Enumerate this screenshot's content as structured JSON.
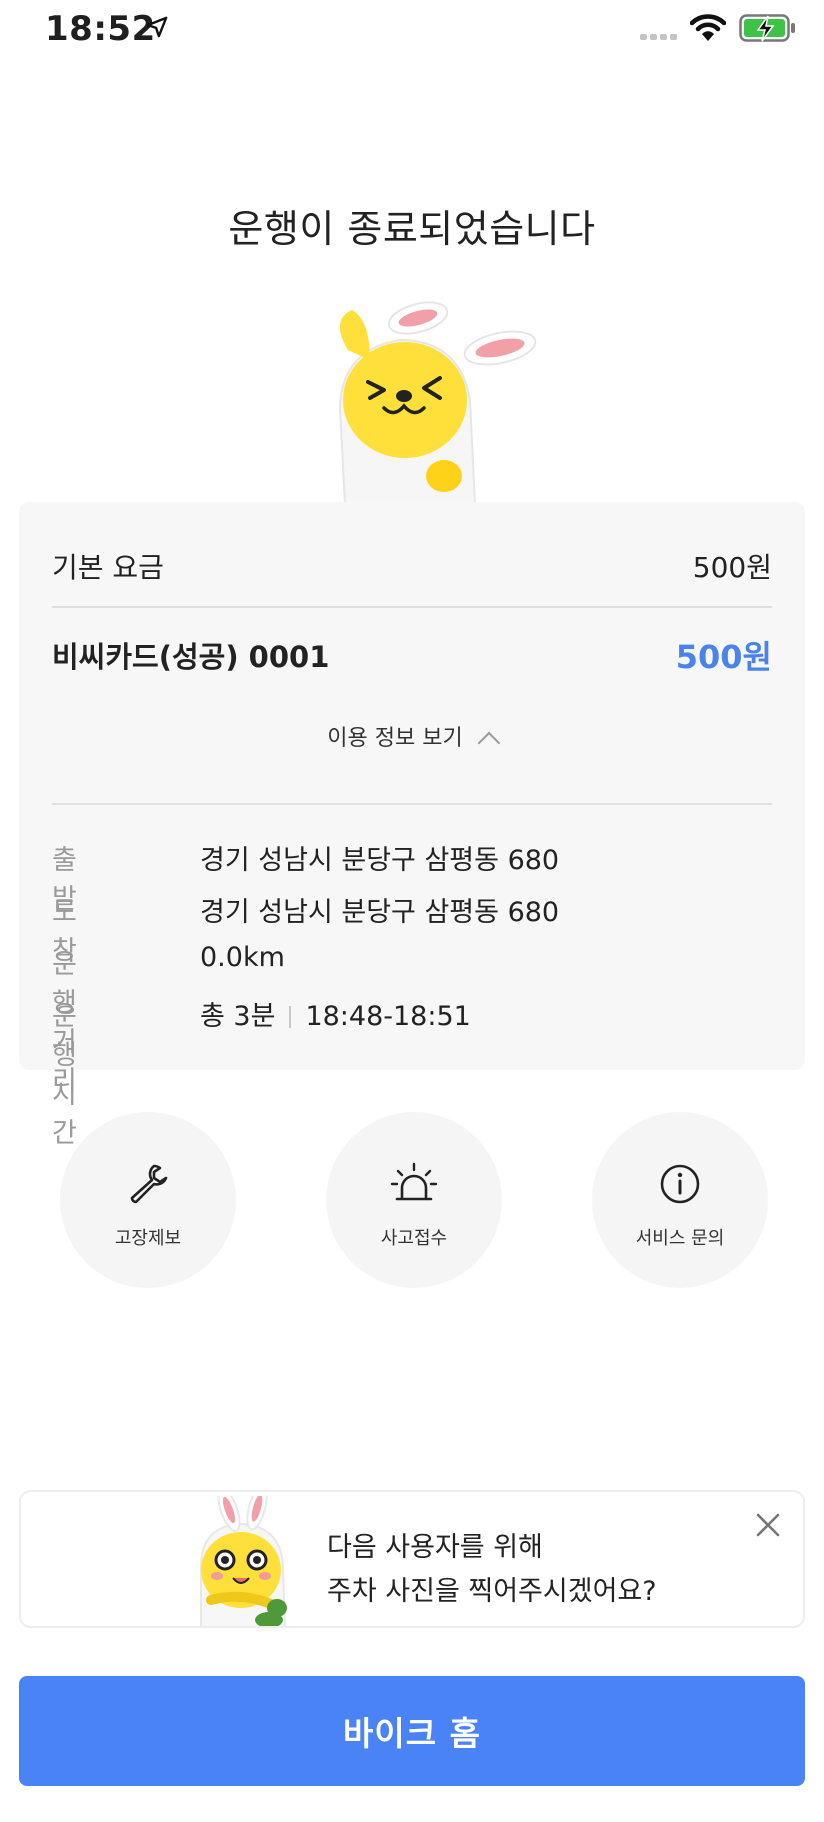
{
  "status_bar": {
    "time": "18:52",
    "icons": [
      "location-arrow-icon",
      "signal-icon",
      "wifi-icon",
      "battery-charging-icon"
    ]
  },
  "title": "운행이 종료되었습니다",
  "receipt": {
    "base_fee_label": "기본 요금",
    "base_fee_value": "500원",
    "card_name": "비씨카드(성공) 0001",
    "card_amount": "500원",
    "toggle_label": "이용 정보 보기",
    "details": [
      {
        "label": "출발",
        "value": "경기 성남시 분당구 삼평동 680"
      },
      {
        "label": "도착",
        "value": "경기 성남시 분당구 삼평동 680"
      },
      {
        "label": "운행 거리",
        "value": "0.0km"
      },
      {
        "label": "운행 시간",
        "total": "총 3분",
        "range": "18:48-18:51"
      }
    ]
  },
  "actions": [
    {
      "label": "고장제보",
      "icon": "wrench-icon"
    },
    {
      "label": "사고접수",
      "icon": "siren-icon"
    },
    {
      "label": "서비스 문의",
      "icon": "info-icon"
    }
  ],
  "banner": {
    "line1": "다음 사용자를 위해",
    "line2": "주차 사진을 찍어주시겠어요?"
  },
  "home_button": "바이크 홈",
  "colors": {
    "accent": "#4a83f5",
    "amount": "#4a83ea",
    "card_bg": "#f7f7f7",
    "mascot_yellow": "#ffe03a"
  }
}
